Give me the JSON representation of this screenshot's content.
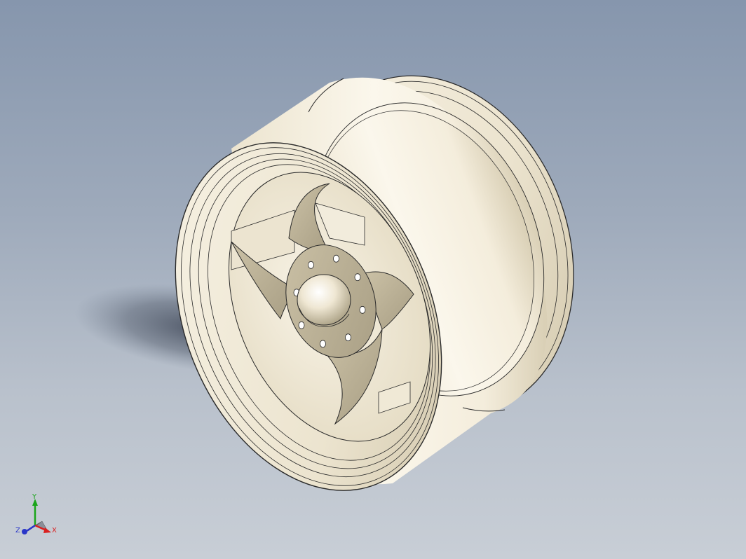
{
  "viewport": {
    "background_top": "#8696ad",
    "background_bottom": "#c8ced6",
    "model_color": "#f1ebda",
    "edge_color": "#2a2a2a"
  },
  "model": {
    "spokes": 4,
    "lug_holes": 8
  },
  "triad": {
    "x_label": "X",
    "y_label": "Y",
    "z_label": "Z",
    "x_color": "#d92020",
    "y_color": "#1aa51a",
    "z_color": "#2a36c8"
  }
}
